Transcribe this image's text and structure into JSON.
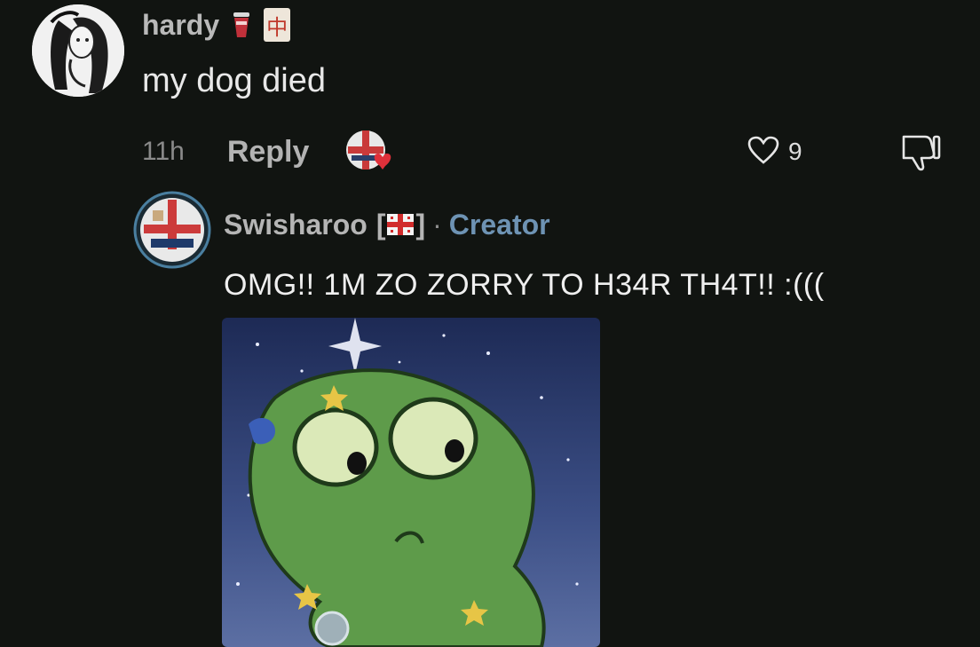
{
  "parent_comment": {
    "username": "hardy",
    "badges": [
      "cup-icon",
      "mahjong-tile-icon"
    ],
    "badge_tile_glyph": "中",
    "text": "my dog died",
    "time": "11h",
    "reply_label": "Reply",
    "like_count": "9"
  },
  "reply_comment": {
    "username": "Swisharoo",
    "bracket_open": "[",
    "bracket_close": "]",
    "separator": "·",
    "role": "Creator",
    "text": "OMG!! 1M ZO ZORRY TO H34R TH4T!! :((("
  },
  "colors": {
    "background": "#111411",
    "creator_accent": "#6e93b4",
    "heart_red": "#e0303a"
  }
}
